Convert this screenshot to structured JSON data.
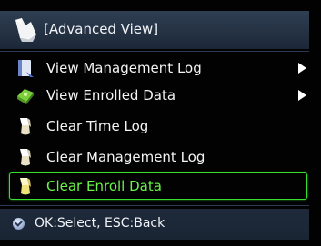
{
  "title_bar": {
    "icon": "advanced-view-icon",
    "title": "[Advanced View]"
  },
  "menu": {
    "items": [
      {
        "label": "View Management Log",
        "icon": "log-book-icon",
        "has_submenu": true,
        "selected": false
      },
      {
        "label": "View Enrolled Data",
        "icon": "enrolled-data-icon",
        "has_submenu": true,
        "selected": false
      },
      {
        "label": "Clear Time Log",
        "icon": "eraser-icon",
        "has_submenu": false,
        "selected": false
      },
      {
        "label": "Clear Management Log",
        "icon": "eraser-icon",
        "has_submenu": false,
        "selected": false
      },
      {
        "label": "Clear Enroll Data",
        "icon": "eraser-icon",
        "has_submenu": false,
        "selected": true
      }
    ]
  },
  "footer": {
    "icon": "info-icon",
    "hint": "OK:Select, ESC:Back"
  },
  "colors": {
    "selection_border": "#38e02e",
    "selected_text": "#6cf24a",
    "bar_background": "#243244"
  }
}
